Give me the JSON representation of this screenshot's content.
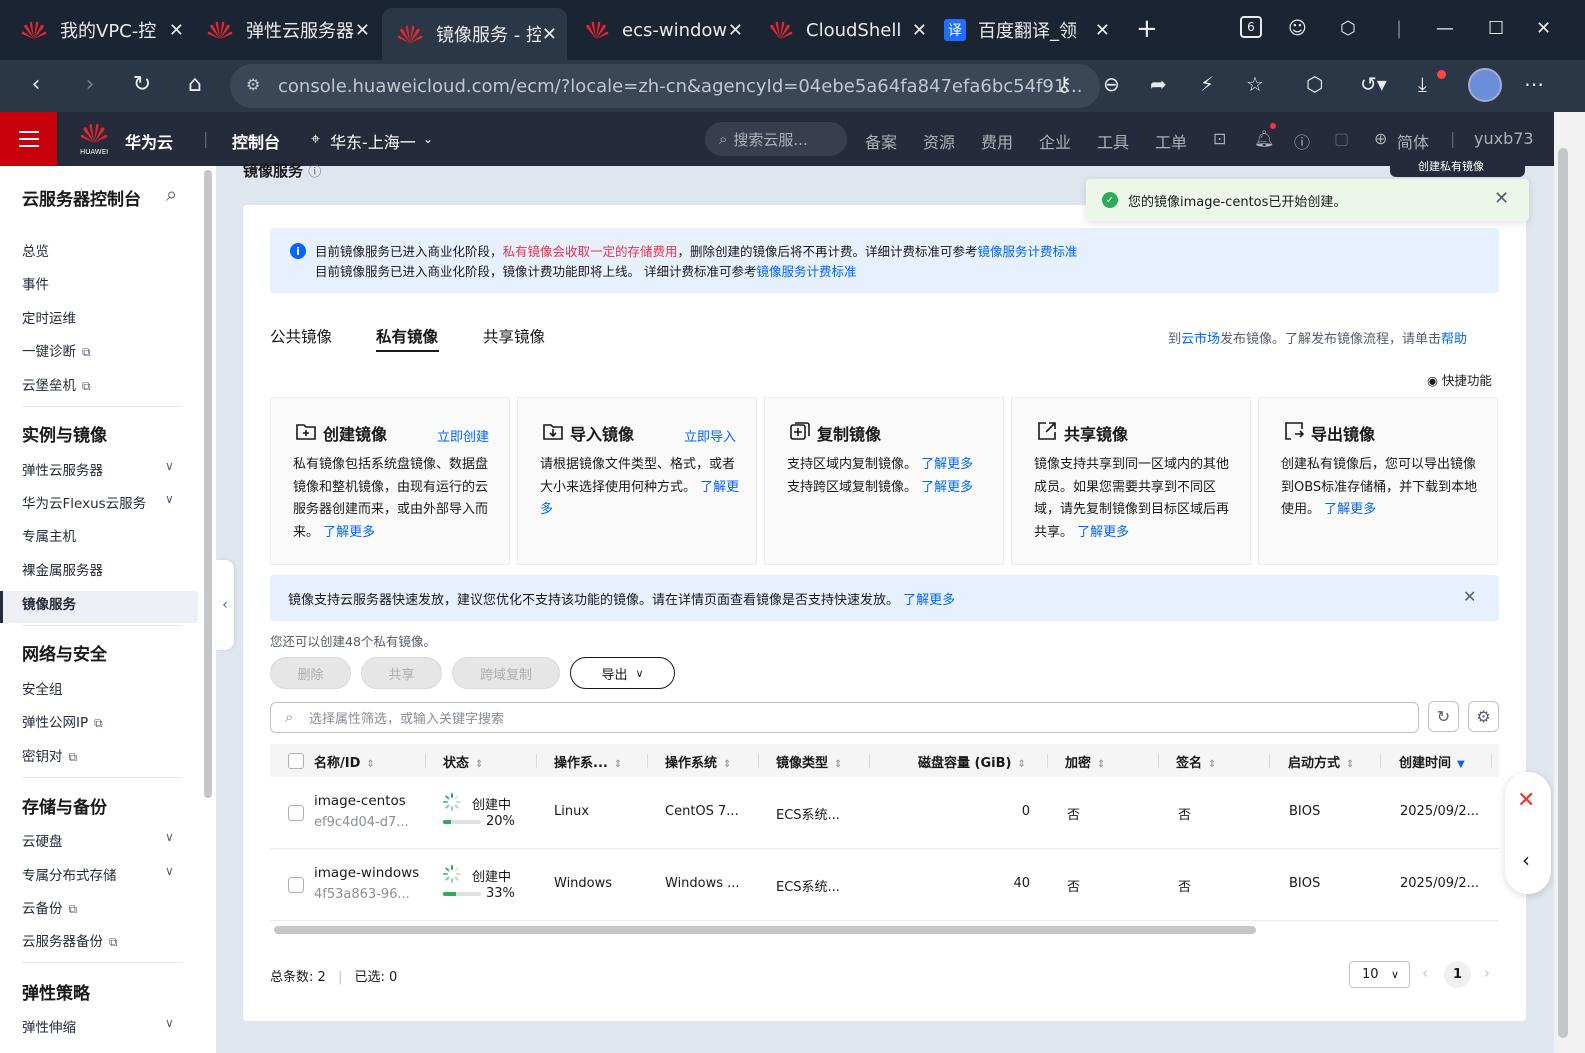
{
  "browser": {
    "tabs": [
      {
        "title": "我的VPC-控",
        "icon": "huawei-logo-icon"
      },
      {
        "title": "弹性云服务器",
        "icon": "huawei-logo-icon"
      },
      {
        "title": "镜像服务 - 控",
        "icon": "huawei-logo-icon",
        "active": true
      },
      {
        "title": "ecs-window",
        "icon": "huawei-logo-icon"
      },
      {
        "title": "CloudShell",
        "icon": "huawei-logo-icon"
      },
      {
        "title": "百度翻译_领",
        "icon": "translate-icon",
        "icon_text": "译"
      }
    ],
    "tab_count_badge": "6",
    "url": "console.huaweicloud.com/ecm/?locale=zh-cn&agencyId=04ebe5a64fa847efa6bc54f91..."
  },
  "header": {
    "brand": "华为云",
    "brand_small": "HUAWEI",
    "console": "控制台",
    "region": "华东-上海一",
    "search_placeholder": "搜索云服...",
    "nav": [
      "备案",
      "资源",
      "费用",
      "企业",
      "工具",
      "工单"
    ],
    "language": "简体",
    "user": "yuxb73"
  },
  "sidebar": {
    "title": "云服务器控制台",
    "top_items": [
      "总览",
      "事件",
      "定时运维",
      "一键诊断",
      "云堡垒机"
    ],
    "sections": [
      {
        "title": "实例与镜像",
        "items": [
          "弹性云服务器",
          "华为云Flexus云服务",
          "专属主机",
          "裸金属服务器",
          "镜像服务"
        ]
      },
      {
        "title": "网络与安全",
        "items": [
          "安全组",
          "弹性公网IP",
          "密钥对"
        ]
      },
      {
        "title": "存储与备份",
        "items": [
          "云硬盘",
          "专属分布式存储",
          "云备份",
          "云服务器备份"
        ]
      },
      {
        "title": "弹性策略",
        "items": [
          "弹性伸缩"
        ]
      }
    ]
  },
  "page": {
    "title": "镜像服务",
    "create_button": "创建私有镜像",
    "toast": "您的镜像image-centos已开始创建。",
    "info": {
      "line1_a": "目前镜像服务已进入商业化阶段，",
      "line1_red": "私有镜像会收取一定的存储费用",
      "line1_b": "，删除创建的镜像后将不再计费。详细计费标准可参考",
      "line1_link": "镜像服务计费标准",
      "line2_a": "目前镜像服务已进入商业化阶段，镜像计费功能即将上线。 详细计费标准可参考",
      "line2_link": "镜像服务计费标准"
    },
    "tabs": [
      "公共镜像",
      "私有镜像",
      "共享镜像"
    ],
    "tabs_right_a": "到",
    "tabs_right_link1": "云市场",
    "tabs_right_b": "发布镜像。了解发布镜像流程，请单击",
    "tabs_right_link2": "帮助",
    "quick_func": "快捷功能",
    "feature_cards": [
      {
        "title": "创建镜像",
        "link": "立即创建",
        "desc": "私有镜像包括系统盘镜像、数据盘镜像和整机镜像，由现有运行的云服务器创建而来，或由外部导入而来。",
        "more": "了解更多"
      },
      {
        "title": "导入镜像",
        "link": "立即导入",
        "desc": "请根据镜像文件类型、格式，或者大小来选择使用何种方式。",
        "more": "了解更多"
      },
      {
        "title": "复制镜像",
        "link": "",
        "desc": "支持区域内复制镜像。 了解更多\n支持跨区域复制镜像。 了解更多",
        "more": ""
      },
      {
        "title": "共享镜像",
        "link": "",
        "desc": "镜像支持共享到同一区域内的其他成员。如果您需要共享到不同区域，请先复制镜像到目标区域后再共享。",
        "more": "了解更多"
      },
      {
        "title": "导出镜像",
        "link": "",
        "desc": "创建私有镜像后，您可以导出镜像到OBS标准存储桶，并下载到本地使用。",
        "more": "了解更多"
      }
    ],
    "notice": "镜像支持云服务器快速发放，建议您优化不支持该功能的镜像。请在详情页面查看镜像是否支持快速发放。",
    "notice_link": "了解更多",
    "quota": "您还可以创建48个私有镜像。",
    "buttons": {
      "delete": "删除",
      "share": "共享",
      "replicate": "跨域复制",
      "export": "导出"
    },
    "filter_placeholder": "选择属性筛选，或输入关键字搜索",
    "columns": [
      "名称/ID",
      "状态",
      "操作系...",
      "操作系统",
      "镜像类型",
      "磁盘容量 (GiB)",
      "加密",
      "签名",
      "启动方式",
      "创建时间"
    ],
    "rows": [
      {
        "name": "image-centos",
        "id": "ef9c4d04-d7...",
        "status": "创建中",
        "progress": "20%",
        "progress_value": 0.2,
        "os_type": "Linux",
        "os": "CentOS 7...",
        "image_type": "ECS系统...",
        "disk": "0",
        "encrypt": "否",
        "sign": "否",
        "boot": "BIOS",
        "created": "2025/09/2..."
      },
      {
        "name": "image-windows",
        "id": "4f53a863-96...",
        "status": "创建中",
        "progress": "33%",
        "progress_value": 0.33,
        "os_type": "Windows",
        "os": "Windows ...",
        "image_type": "ECS系统...",
        "disk": "40",
        "encrypt": "否",
        "sign": "否",
        "boot": "BIOS",
        "created": "2025/09/2..."
      }
    ],
    "footer": {
      "total_label": "总条数:",
      "total": "2",
      "selected_label": "已选:",
      "selected": "0",
      "page_size": "10",
      "page": "1"
    }
  },
  "colors": {
    "brand_red": "#c7000b",
    "link_blue": "#0066ff",
    "success_green": "#2dab59",
    "header_dark": "#252b3a"
  }
}
